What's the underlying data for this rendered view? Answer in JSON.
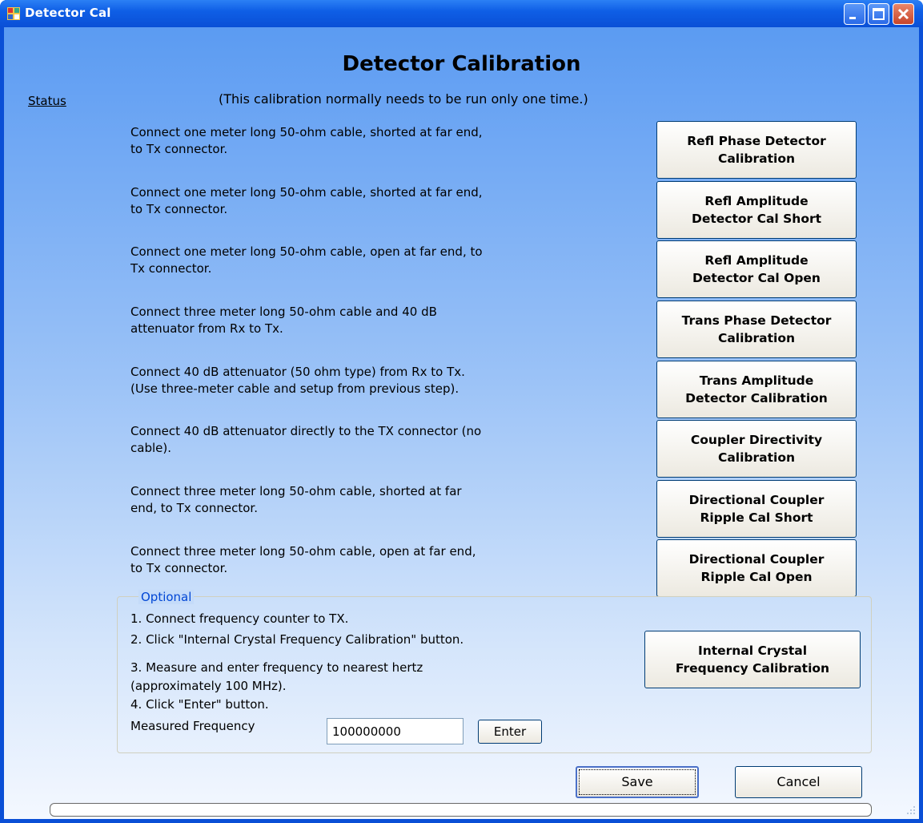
{
  "window": {
    "title": "Detector Cal",
    "colors": {
      "titlebar": "#0a4fd6",
      "close": "#c8452a"
    }
  },
  "header": {
    "heading": "Detector Calibration",
    "status_link": "Status",
    "subtitle": "(This calibration normally needs to be run only one time.)"
  },
  "steps": [
    {
      "line1": "Connect one meter long 50-ohm cable, shorted at far end,",
      "line2": "to Tx connector.",
      "button_line1": "Refl Phase Detector",
      "button_line2": "Calibration"
    },
    {
      "line1": "Connect one meter long 50-ohm cable, shorted at far end,",
      "line2": "to Tx connector.",
      "button_line1": "Refl Amplitude",
      "button_line2": "Detector Cal Short"
    },
    {
      "line1": "Connect one meter long 50-ohm cable, open at far end, to",
      "line2": "Tx connector.",
      "button_line1": "Refl Amplitude",
      "button_line2": "Detector Cal Open"
    },
    {
      "line1": "Connect three meter long 50-ohm cable and 40 dB",
      "line2": "attenuator from Rx to Tx.",
      "button_line1": "Trans Phase Detector",
      "button_line2": "Calibration"
    },
    {
      "line1": "Connect 40 dB attenuator (50 ohm type) from Rx to Tx.",
      "line2": "(Use three-meter cable and setup from previous step).",
      "button_line1": "Trans Amplitude",
      "button_line2": "Detector Calibration"
    },
    {
      "line1": "Connect 40 dB attenuator directly to the TX connector (no",
      "line2": "cable).",
      "button_line1": "Coupler Directivity",
      "button_line2": "Calibration"
    },
    {
      "line1": "Connect three meter long 50-ohm cable, shorted at far",
      "line2": "end, to Tx connector.",
      "button_line1": "Directional Coupler",
      "button_line2": "Ripple Cal Short"
    },
    {
      "line1": "Connect three meter long 50-ohm cable, open at far end,",
      "line2": "to Tx connector.",
      "button_line1": "Directional Coupler",
      "button_line2": "Ripple Cal Open"
    }
  ],
  "optional": {
    "legend": "Optional",
    "line1": "1. Connect frequency counter to TX.",
    "line2": "2. Click \"Internal Crystal Frequency Calibration\" button.",
    "line3": "3. Measure and enter frequency to nearest hertz",
    "line4": "(approximately 100 MHz).",
    "line5": "4. Click \"Enter\" button.",
    "freq_label": "Measured Frequency",
    "freq_value": "100000000",
    "enter_label": "Enter",
    "crystal_button_line1": "Internal Crystal",
    "crystal_button_line2": "Frequency Calibration"
  },
  "footer": {
    "save_label": "Save",
    "cancel_label": "Cancel",
    "progress": 0
  }
}
